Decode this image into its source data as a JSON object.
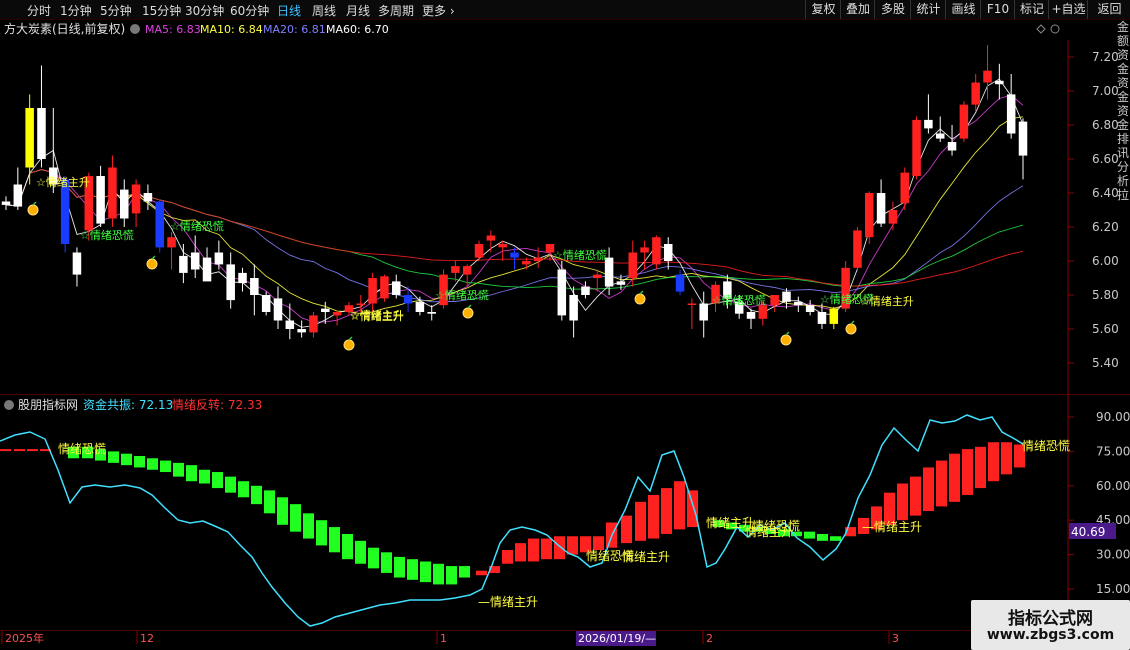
{
  "toolbar": {
    "timeframes": [
      "分时",
      "1分钟",
      "5分钟",
      "15分钟",
      "30分钟",
      "60分钟",
      "日线",
      "周线",
      "月线",
      "多周期",
      "更多"
    ],
    "active_timeframe": "日线",
    "buttons": [
      "复权",
      "叠加",
      "多股",
      "统计",
      "画线",
      "F10",
      "标记",
      "+自选",
      "返回"
    ]
  },
  "main_chart": {
    "title": "方大炭素(日线,前复权)",
    "ma_labels": [
      {
        "text": "MA5: 6.83",
        "color": "#e040e0"
      },
      {
        "text": "MA10: 6.84",
        "color": "#ffff40"
      },
      {
        "text": "MA20: 6.81",
        "color": "#8080ff"
      },
      {
        "text": "MA60: 6.70",
        "color": "#ffffff"
      }
    ],
    "price_ticks": [
      "7.20",
      "7.00",
      "6.80",
      "6.60",
      "6.40",
      "6.20",
      "6.00",
      "5.80",
      "5.60",
      "5.40"
    ],
    "signals": [
      "☆情绪主升",
      "☆情绪恐慌",
      "☆情绪主升",
      "☆情绪恐慌",
      "☆情绪恐慌",
      "☆情绪恐慌",
      "☆情绪恐慌",
      "☆情绪主升",
      "☆情绪恐慌",
      "☆情绪主升"
    ]
  },
  "sub_chart": {
    "title": "股朋指标网",
    "labels": [
      {
        "text": "资金共振: 72.13",
        "color": "#40e0ff"
      },
      {
        "text": "情绪反转: 72.33",
        "color": "#ff3030"
      }
    ],
    "ticks": [
      "90.00",
      "75.00",
      "60.00",
      "45.00",
      "30.00",
      "15.00"
    ],
    "current_value": "40.69",
    "signals": [
      "情绪恐慌",
      "情绪主升",
      "情绪恐慌",
      "情绪主升",
      "情绪恐慌",
      "情绪主升",
      "情绪恐慌",
      "情绪主升",
      "情绪主升",
      "情绪恐慌"
    ]
  },
  "date_axis": {
    "labels": [
      "2025年",
      "12",
      "1",
      "2026/01/19/—",
      "2",
      "3"
    ]
  },
  "right_side_text": "金额资金资金资金排讯分析拉",
  "watermark": {
    "title": "指标公式网",
    "url": "www.zbgs3.com"
  },
  "colors": {
    "up": "#ff2020",
    "down": "#ffffff",
    "accent": "#3fc0ff",
    "green": "#20ff20",
    "cyan": "#40e0ff",
    "red": "#ff2020",
    "yellow": "#ffff00",
    "blue": "#2020ff"
  },
  "chart_data": [
    {
      "type": "candlestick",
      "title": "方大炭素(日线,前复权)",
      "ylim": [
        5.3,
        7.3
      ],
      "series": [
        {
          "name": "MA5",
          "last": 6.83
        },
        {
          "name": "MA10",
          "last": 6.84
        },
        {
          "name": "MA20",
          "last": 6.81
        },
        {
          "name": "MA60",
          "last": 6.7
        }
      ],
      "candles": [
        [
          6.35,
          6.38,
          6.3,
          6.33
        ],
        [
          6.45,
          6.55,
          6.3,
          6.32
        ],
        [
          6.55,
          6.98,
          6.45,
          6.9
        ],
        [
          6.9,
          7.15,
          6.55,
          6.6
        ],
        [
          6.55,
          6.9,
          6.4,
          6.45
        ],
        [
          6.48,
          6.5,
          6.05,
          6.1
        ],
        [
          6.05,
          6.08,
          5.85,
          5.92
        ],
        [
          6.18,
          6.52,
          6.12,
          6.5
        ],
        [
          6.5,
          6.56,
          6.2,
          6.22
        ],
        [
          6.25,
          6.62,
          6.2,
          6.55
        ],
        [
          6.42,
          6.48,
          6.2,
          6.25
        ],
        [
          6.28,
          6.48,
          6.2,
          6.45
        ],
        [
          6.4,
          6.45,
          6.3,
          6.35
        ],
        [
          6.35,
          6.36,
          6.05,
          6.08
        ],
        [
          6.08,
          6.17,
          5.95,
          6.14
        ],
        [
          6.03,
          6.1,
          5.87,
          5.93
        ],
        [
          6.05,
          6.15,
          5.9,
          5.95
        ],
        [
          6.02,
          6.08,
          5.88,
          5.88
        ],
        [
          6.05,
          6.12,
          5.95,
          5.98
        ],
        [
          5.98,
          6.05,
          5.72,
          5.77
        ],
        [
          5.93,
          5.96,
          5.82,
          5.87
        ],
        [
          5.9,
          5.98,
          5.68,
          5.8
        ],
        [
          5.8,
          5.82,
          5.68,
          5.7
        ],
        [
          5.78,
          5.85,
          5.6,
          5.65
        ],
        [
          5.65,
          5.75,
          5.54,
          5.6
        ],
        [
          5.6,
          5.65,
          5.55,
          5.58
        ],
        [
          5.58,
          5.7,
          5.55,
          5.68
        ],
        [
          5.72,
          5.76,
          5.63,
          5.7
        ],
        [
          5.68,
          5.71,
          5.62,
          5.7
        ],
        [
          5.7,
          5.76,
          5.68,
          5.74
        ],
        [
          5.74,
          5.8,
          5.7,
          5.75
        ],
        [
          5.75,
          5.93,
          5.7,
          5.9
        ],
        [
          5.78,
          5.92,
          5.76,
          5.91
        ],
        [
          5.88,
          5.92,
          5.78,
          5.8
        ],
        [
          5.75,
          5.85,
          5.7,
          5.8
        ],
        [
          5.76,
          5.79,
          5.68,
          5.7
        ],
        [
          5.7,
          5.74,
          5.65,
          5.69
        ],
        [
          5.74,
          5.95,
          5.72,
          5.92
        ],
        [
          5.93,
          6.0,
          5.88,
          5.97
        ],
        [
          5.92,
          5.98,
          5.85,
          5.97
        ],
        [
          6.02,
          6.12,
          6.0,
          6.1
        ],
        [
          6.12,
          6.18,
          6.05,
          6.15
        ],
        [
          6.08,
          6.12,
          6.0,
          6.1
        ],
        [
          6.05,
          6.08,
          5.95,
          6.02
        ],
        [
          5.98,
          6.02,
          5.95,
          6.0
        ],
        [
          6.0,
          6.08,
          5.96,
          6.02
        ],
        [
          6.05,
          6.1,
          6.0,
          6.1
        ],
        [
          5.95,
          6.0,
          5.65,
          5.68
        ],
        [
          5.8,
          5.85,
          5.55,
          5.65
        ],
        [
          5.85,
          5.88,
          5.78,
          5.8
        ],
        [
          5.9,
          5.95,
          5.82,
          5.92
        ],
        [
          6.02,
          6.08,
          5.8,
          5.85
        ],
        [
          5.88,
          5.92,
          5.83,
          5.86
        ],
        [
          5.9,
          6.12,
          5.85,
          6.05
        ],
        [
          6.05,
          6.12,
          5.95,
          6.08
        ],
        [
          5.98,
          6.15,
          5.95,
          6.14
        ],
        [
          6.1,
          6.14,
          5.95,
          6.0
        ],
        [
          5.92,
          5.95,
          5.8,
          5.82
        ],
        [
          5.75,
          5.78,
          5.6,
          5.75
        ],
        [
          5.75,
          5.82,
          5.55,
          5.65
        ],
        [
          5.75,
          5.88,
          5.7,
          5.86
        ],
        [
          5.88,
          5.92,
          5.72,
          5.78
        ],
        [
          5.76,
          5.8,
          5.66,
          5.69
        ],
        [
          5.7,
          5.72,
          5.6,
          5.66
        ],
        [
          5.66,
          5.76,
          5.62,
          5.74
        ],
        [
          5.74,
          5.8,
          5.7,
          5.8
        ],
        [
          5.82,
          5.84,
          5.72,
          5.76
        ],
        [
          5.76,
          5.79,
          5.7,
          5.74
        ],
        [
          5.74,
          5.77,
          5.68,
          5.7
        ],
        [
          5.7,
          5.75,
          5.6,
          5.63
        ],
        [
          5.63,
          5.73,
          5.6,
          5.72
        ],
        [
          5.72,
          6.0,
          5.7,
          5.96
        ],
        [
          5.96,
          6.2,
          5.94,
          6.18
        ],
        [
          6.14,
          6.41,
          6.1,
          6.4
        ],
        [
          6.4,
          6.48,
          6.2,
          6.22
        ],
        [
          6.22,
          6.35,
          6.18,
          6.3
        ],
        [
          6.34,
          6.55,
          6.3,
          6.52
        ],
        [
          6.5,
          6.85,
          6.48,
          6.83
        ],
        [
          6.83,
          6.98,
          6.75,
          6.78
        ],
        [
          6.75,
          6.85,
          6.7,
          6.72
        ],
        [
          6.7,
          6.8,
          6.62,
          6.65
        ],
        [
          6.72,
          6.94,
          6.7,
          6.92
        ],
        [
          6.92,
          7.1,
          6.88,
          7.05
        ],
        [
          7.05,
          7.27,
          6.95,
          7.12
        ],
        [
          7.06,
          7.16,
          6.95,
          7.04
        ],
        [
          6.98,
          7.1,
          6.72,
          6.75
        ],
        [
          6.82,
          6.84,
          6.48,
          6.62
        ]
      ]
    },
    {
      "type": "line",
      "title": "股朋指标网",
      "ylim": [
        0,
        100
      ],
      "series": [
        {
          "name": "资金共振",
          "last": 72.13
        },
        {
          "name": "情绪反转",
          "last": 72.33
        }
      ]
    }
  ]
}
